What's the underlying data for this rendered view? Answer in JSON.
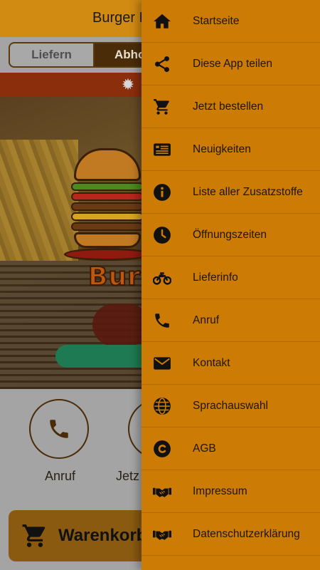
{
  "app": {
    "title": "Burger B"
  },
  "order_mode": {
    "delivery_label": "Liefern",
    "pickup_label": "Abho"
  },
  "logo": {
    "text": "Bur"
  },
  "quick_actions": {
    "call_label": "Anruf",
    "order_label": "Jetz"
  },
  "cart": {
    "label": "Warenkorb"
  },
  "drawer": {
    "items": [
      {
        "label": "Startseite",
        "icon": "home-icon"
      },
      {
        "label": "Diese App teilen",
        "icon": "share-icon"
      },
      {
        "label": "Jetzt bestellen",
        "icon": "cart-icon"
      },
      {
        "label": "Neuigkeiten",
        "icon": "news-icon"
      },
      {
        "label": "Liste aller Zusatzstoffe",
        "icon": "info-icon"
      },
      {
        "label": "Öffnungszeiten",
        "icon": "clock-icon"
      },
      {
        "label": "Lieferinfo",
        "icon": "motorcycle-icon"
      },
      {
        "label": "Anruf",
        "icon": "phone-icon"
      },
      {
        "label": "Kontakt",
        "icon": "envelope-icon"
      },
      {
        "label": "Sprachauswahl",
        "icon": "globe-icon"
      },
      {
        "label": "AGB",
        "icon": "copyright-icon"
      },
      {
        "label": "Impressum",
        "icon": "handshake-icon"
      },
      {
        "label": "Datenschutzerklärung",
        "icon": "handshake-icon"
      }
    ]
  },
  "colors": {
    "drawer_bg": "#cc7c04",
    "topbar": "#d18a12",
    "pickup_active": "#4a2d08",
    "promo_strip": "#8a2e0c"
  }
}
